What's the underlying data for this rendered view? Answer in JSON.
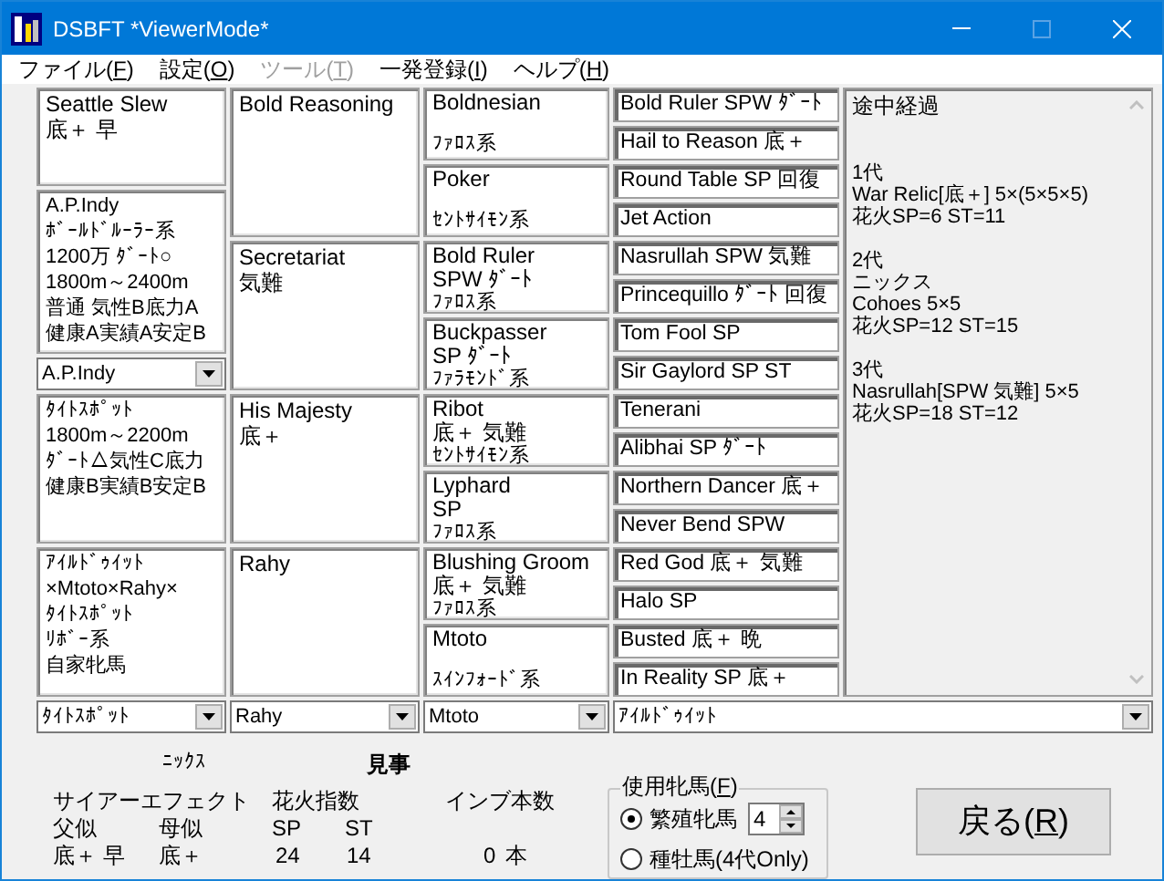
{
  "window": {
    "title": "DSBFT *ViewerMode*"
  },
  "menu": [
    {
      "before": "ファイル(",
      "key": "F",
      "after": ")",
      "disabled": false
    },
    {
      "before": "設定(",
      "key": "O",
      "after": ")",
      "disabled": false
    },
    {
      "before": "ツール(",
      "key": "T",
      "after": ")",
      "disabled": true
    },
    {
      "before": "一発登録(",
      "key": "I",
      "after": ")",
      "disabled": false
    },
    {
      "before": "ヘルプ(",
      "key": "H",
      "after": ")",
      "disabled": false
    }
  ],
  "pedigree": {
    "col1": {
      "top": {
        "lines": [
          "Seattle Slew",
          "底＋ 早"
        ]
      },
      "main": {
        "lines": [
          "A.P.Indy",
          "ﾎﾞｰﾙﾄﾞﾙｰﾗｰ系",
          "1200万 ﾀﾞｰﾄ○",
          "1800m～2400m",
          "普通 気性B底力A",
          "健康A実績A安定B"
        ]
      },
      "combo": "A.P.Indy",
      "dam_sire": {
        "lines": [
          "ﾀｲﾄｽﾎﾟｯﾄ",
          "1800m～2200m",
          "ﾀﾞｰﾄ△気性C底力",
          "健康B実績B安定B"
        ]
      },
      "dam": {
        "lines": [
          "ｱｲﾙﾄﾞｩｲｯﾄ",
          "×Mtoto×Rahy×",
          "ﾀｲﾄｽﾎﾟｯﾄ",
          "ﾘﾎﾞｰ系",
          "自家牝馬"
        ]
      }
    },
    "col2": [
      {
        "lines": [
          "Bold Reasoning"
        ]
      },
      {
        "lines": [
          "Secretariat",
          "気難"
        ]
      },
      {
        "lines": [
          "His Majesty",
          "底＋"
        ]
      },
      {
        "lines": [
          "Rahy"
        ]
      }
    ],
    "col3": [
      {
        "name": "Boldnesian",
        "line": "ﾌｧﾛｽ系"
      },
      {
        "name": "Poker",
        "line": "ｾﾝﾄｻｲﾓﾝ系"
      },
      {
        "name": "Bold Ruler",
        "traits": "SPW ﾀﾞｰﾄ",
        "line": "ﾌｧﾛｽ系"
      },
      {
        "name": "Buckpasser",
        "traits": "SP ﾀﾞｰﾄ",
        "line": "ﾌｧﾗﾓﾝﾄﾞ系"
      },
      {
        "name": "Ribot",
        "traits": "底＋ 気難",
        "line": "ｾﾝﾄｻｲﾓﾝ系"
      },
      {
        "name": "Lyphard",
        "traits": "SP",
        "line": "ﾌｧﾛｽ系"
      },
      {
        "name": "Blushing Groom",
        "traits": "底＋ 気難",
        "line": "ﾌｧﾛｽ系"
      },
      {
        "name": "Mtoto",
        "line": "ｽｲﾝﾌｫｰﾄﾞ系"
      }
    ],
    "col4": [
      "Bold Ruler SPW ﾀﾞｰﾄ",
      "Hail to Reason 底＋",
      "Round Table SP 回復",
      "Jet Action",
      "Nasrullah SPW 気難",
      "Princequillo ﾀﾞｰﾄ 回復",
      "Tom Fool SP",
      "Sir Gaylord SP ST",
      "Tenerani",
      "Alibhai SP ﾀﾞｰﾄ",
      "Northern Dancer 底＋",
      "Never Bend SPW",
      "Red God 底＋ 気難",
      "Halo SP",
      "Busted 底＋ 晩",
      "In Reality SP 底＋"
    ],
    "progress": {
      "title": "途中経過",
      "sections": [
        {
          "generation": "1代",
          "lines": [
            "War Relic[底＋] 5×(5×5×5)",
            "花火SP=6 ST=11"
          ]
        },
        {
          "generation": "2代",
          "lines": [
            "ニックス",
            "Cohoes 5×5",
            "花火SP=12 ST=15"
          ]
        },
        {
          "generation": "3代",
          "lines": [
            "Nasrullah[SPW 気難] 5×5",
            "花火SP=18 ST=12"
          ]
        }
      ]
    }
  },
  "bottom_combos": [
    "ﾀｲﾄｽﾎﾟｯﾄ",
    "Rahy",
    "Mtoto",
    "ｱｲﾙﾄﾞｩｲｯﾄ"
  ],
  "summary": {
    "nicks_label": "ﾆｯｸｽ",
    "nicks_value": "見事",
    "sire_effect": {
      "label": "サイアーエフェクト",
      "sire_label": "父似",
      "dam_label": "母似",
      "sire_value": "底＋ 早",
      "dam_value": "底＋"
    },
    "fireworks": {
      "label": "花火指数",
      "sp_label": "SP",
      "st_label": "ST",
      "sp": "24",
      "st": "14"
    },
    "inbreed": {
      "label": "インブ本数",
      "count": "0",
      "unit": "本"
    }
  },
  "mare_group": {
    "before": "使用牝馬(",
    "key": "F",
    "after": ")",
    "options": [
      {
        "label": "繁殖牝馬",
        "selected": true,
        "spin": "4"
      },
      {
        "label": "種牡馬(4代Only)",
        "selected": false
      }
    ]
  },
  "back_button": {
    "before": "戻る(",
    "key": "R",
    "after": ")"
  }
}
